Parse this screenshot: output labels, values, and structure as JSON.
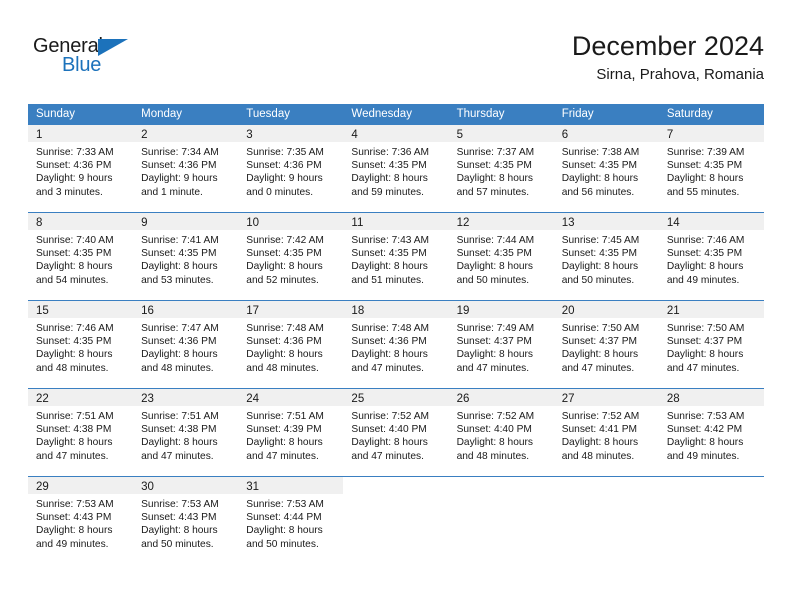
{
  "brand": {
    "name_part1": "General",
    "name_part2": "Blue"
  },
  "header": {
    "month_title": "December 2024",
    "location": "Sirna, Prahova, Romania"
  },
  "weekday_headers": [
    "Sunday",
    "Monday",
    "Tuesday",
    "Wednesday",
    "Thursday",
    "Friday",
    "Saturday"
  ],
  "colors": {
    "header_blue": "#3a7fc1",
    "brand_blue": "#1c72bb",
    "day_band_gray": "#f0f0f0",
    "text": "#1a1a1a"
  },
  "weeks": [
    [
      {
        "day": "1",
        "sunrise": "Sunrise: 7:33 AM",
        "sunset": "Sunset: 4:36 PM",
        "daylight_1": "Daylight: 9 hours",
        "daylight_2": "and 3 minutes."
      },
      {
        "day": "2",
        "sunrise": "Sunrise: 7:34 AM",
        "sunset": "Sunset: 4:36 PM",
        "daylight_1": "Daylight: 9 hours",
        "daylight_2": "and 1 minute."
      },
      {
        "day": "3",
        "sunrise": "Sunrise: 7:35 AM",
        "sunset": "Sunset: 4:36 PM",
        "daylight_1": "Daylight: 9 hours",
        "daylight_2": "and 0 minutes."
      },
      {
        "day": "4",
        "sunrise": "Sunrise: 7:36 AM",
        "sunset": "Sunset: 4:35 PM",
        "daylight_1": "Daylight: 8 hours",
        "daylight_2": "and 59 minutes."
      },
      {
        "day": "5",
        "sunrise": "Sunrise: 7:37 AM",
        "sunset": "Sunset: 4:35 PM",
        "daylight_1": "Daylight: 8 hours",
        "daylight_2": "and 57 minutes."
      },
      {
        "day": "6",
        "sunrise": "Sunrise: 7:38 AM",
        "sunset": "Sunset: 4:35 PM",
        "daylight_1": "Daylight: 8 hours",
        "daylight_2": "and 56 minutes."
      },
      {
        "day": "7",
        "sunrise": "Sunrise: 7:39 AM",
        "sunset": "Sunset: 4:35 PM",
        "daylight_1": "Daylight: 8 hours",
        "daylight_2": "and 55 minutes."
      }
    ],
    [
      {
        "day": "8",
        "sunrise": "Sunrise: 7:40 AM",
        "sunset": "Sunset: 4:35 PM",
        "daylight_1": "Daylight: 8 hours",
        "daylight_2": "and 54 minutes."
      },
      {
        "day": "9",
        "sunrise": "Sunrise: 7:41 AM",
        "sunset": "Sunset: 4:35 PM",
        "daylight_1": "Daylight: 8 hours",
        "daylight_2": "and 53 minutes."
      },
      {
        "day": "10",
        "sunrise": "Sunrise: 7:42 AM",
        "sunset": "Sunset: 4:35 PM",
        "daylight_1": "Daylight: 8 hours",
        "daylight_2": "and 52 minutes."
      },
      {
        "day": "11",
        "sunrise": "Sunrise: 7:43 AM",
        "sunset": "Sunset: 4:35 PM",
        "daylight_1": "Daylight: 8 hours",
        "daylight_2": "and 51 minutes."
      },
      {
        "day": "12",
        "sunrise": "Sunrise: 7:44 AM",
        "sunset": "Sunset: 4:35 PM",
        "daylight_1": "Daylight: 8 hours",
        "daylight_2": "and 50 minutes."
      },
      {
        "day": "13",
        "sunrise": "Sunrise: 7:45 AM",
        "sunset": "Sunset: 4:35 PM",
        "daylight_1": "Daylight: 8 hours",
        "daylight_2": "and 50 minutes."
      },
      {
        "day": "14",
        "sunrise": "Sunrise: 7:46 AM",
        "sunset": "Sunset: 4:35 PM",
        "daylight_1": "Daylight: 8 hours",
        "daylight_2": "and 49 minutes."
      }
    ],
    [
      {
        "day": "15",
        "sunrise": "Sunrise: 7:46 AM",
        "sunset": "Sunset: 4:35 PM",
        "daylight_1": "Daylight: 8 hours",
        "daylight_2": "and 48 minutes."
      },
      {
        "day": "16",
        "sunrise": "Sunrise: 7:47 AM",
        "sunset": "Sunset: 4:36 PM",
        "daylight_1": "Daylight: 8 hours",
        "daylight_2": "and 48 minutes."
      },
      {
        "day": "17",
        "sunrise": "Sunrise: 7:48 AM",
        "sunset": "Sunset: 4:36 PM",
        "daylight_1": "Daylight: 8 hours",
        "daylight_2": "and 48 minutes."
      },
      {
        "day": "18",
        "sunrise": "Sunrise: 7:48 AM",
        "sunset": "Sunset: 4:36 PM",
        "daylight_1": "Daylight: 8 hours",
        "daylight_2": "and 47 minutes."
      },
      {
        "day": "19",
        "sunrise": "Sunrise: 7:49 AM",
        "sunset": "Sunset: 4:37 PM",
        "daylight_1": "Daylight: 8 hours",
        "daylight_2": "and 47 minutes."
      },
      {
        "day": "20",
        "sunrise": "Sunrise: 7:50 AM",
        "sunset": "Sunset: 4:37 PM",
        "daylight_1": "Daylight: 8 hours",
        "daylight_2": "and 47 minutes."
      },
      {
        "day": "21",
        "sunrise": "Sunrise: 7:50 AM",
        "sunset": "Sunset: 4:37 PM",
        "daylight_1": "Daylight: 8 hours",
        "daylight_2": "and 47 minutes."
      }
    ],
    [
      {
        "day": "22",
        "sunrise": "Sunrise: 7:51 AM",
        "sunset": "Sunset: 4:38 PM",
        "daylight_1": "Daylight: 8 hours",
        "daylight_2": "and 47 minutes."
      },
      {
        "day": "23",
        "sunrise": "Sunrise: 7:51 AM",
        "sunset": "Sunset: 4:38 PM",
        "daylight_1": "Daylight: 8 hours",
        "daylight_2": "and 47 minutes."
      },
      {
        "day": "24",
        "sunrise": "Sunrise: 7:51 AM",
        "sunset": "Sunset: 4:39 PM",
        "daylight_1": "Daylight: 8 hours",
        "daylight_2": "and 47 minutes."
      },
      {
        "day": "25",
        "sunrise": "Sunrise: 7:52 AM",
        "sunset": "Sunset: 4:40 PM",
        "daylight_1": "Daylight: 8 hours",
        "daylight_2": "and 47 minutes."
      },
      {
        "day": "26",
        "sunrise": "Sunrise: 7:52 AM",
        "sunset": "Sunset: 4:40 PM",
        "daylight_1": "Daylight: 8 hours",
        "daylight_2": "and 48 minutes."
      },
      {
        "day": "27",
        "sunrise": "Sunrise: 7:52 AM",
        "sunset": "Sunset: 4:41 PM",
        "daylight_1": "Daylight: 8 hours",
        "daylight_2": "and 48 minutes."
      },
      {
        "day": "28",
        "sunrise": "Sunrise: 7:53 AM",
        "sunset": "Sunset: 4:42 PM",
        "daylight_1": "Daylight: 8 hours",
        "daylight_2": "and 49 minutes."
      }
    ],
    [
      {
        "day": "29",
        "sunrise": "Sunrise: 7:53 AM",
        "sunset": "Sunset: 4:43 PM",
        "daylight_1": "Daylight: 8 hours",
        "daylight_2": "and 49 minutes."
      },
      {
        "day": "30",
        "sunrise": "Sunrise: 7:53 AM",
        "sunset": "Sunset: 4:43 PM",
        "daylight_1": "Daylight: 8 hours",
        "daylight_2": "and 50 minutes."
      },
      {
        "day": "31",
        "sunrise": "Sunrise: 7:53 AM",
        "sunset": "Sunset: 4:44 PM",
        "daylight_1": "Daylight: 8 hours",
        "daylight_2": "and 50 minutes."
      },
      {
        "day": "",
        "sunrise": "",
        "sunset": "",
        "daylight_1": "",
        "daylight_2": ""
      },
      {
        "day": "",
        "sunrise": "",
        "sunset": "",
        "daylight_1": "",
        "daylight_2": ""
      },
      {
        "day": "",
        "sunrise": "",
        "sunset": "",
        "daylight_1": "",
        "daylight_2": ""
      },
      {
        "day": "",
        "sunrise": "",
        "sunset": "",
        "daylight_1": "",
        "daylight_2": ""
      }
    ]
  ]
}
